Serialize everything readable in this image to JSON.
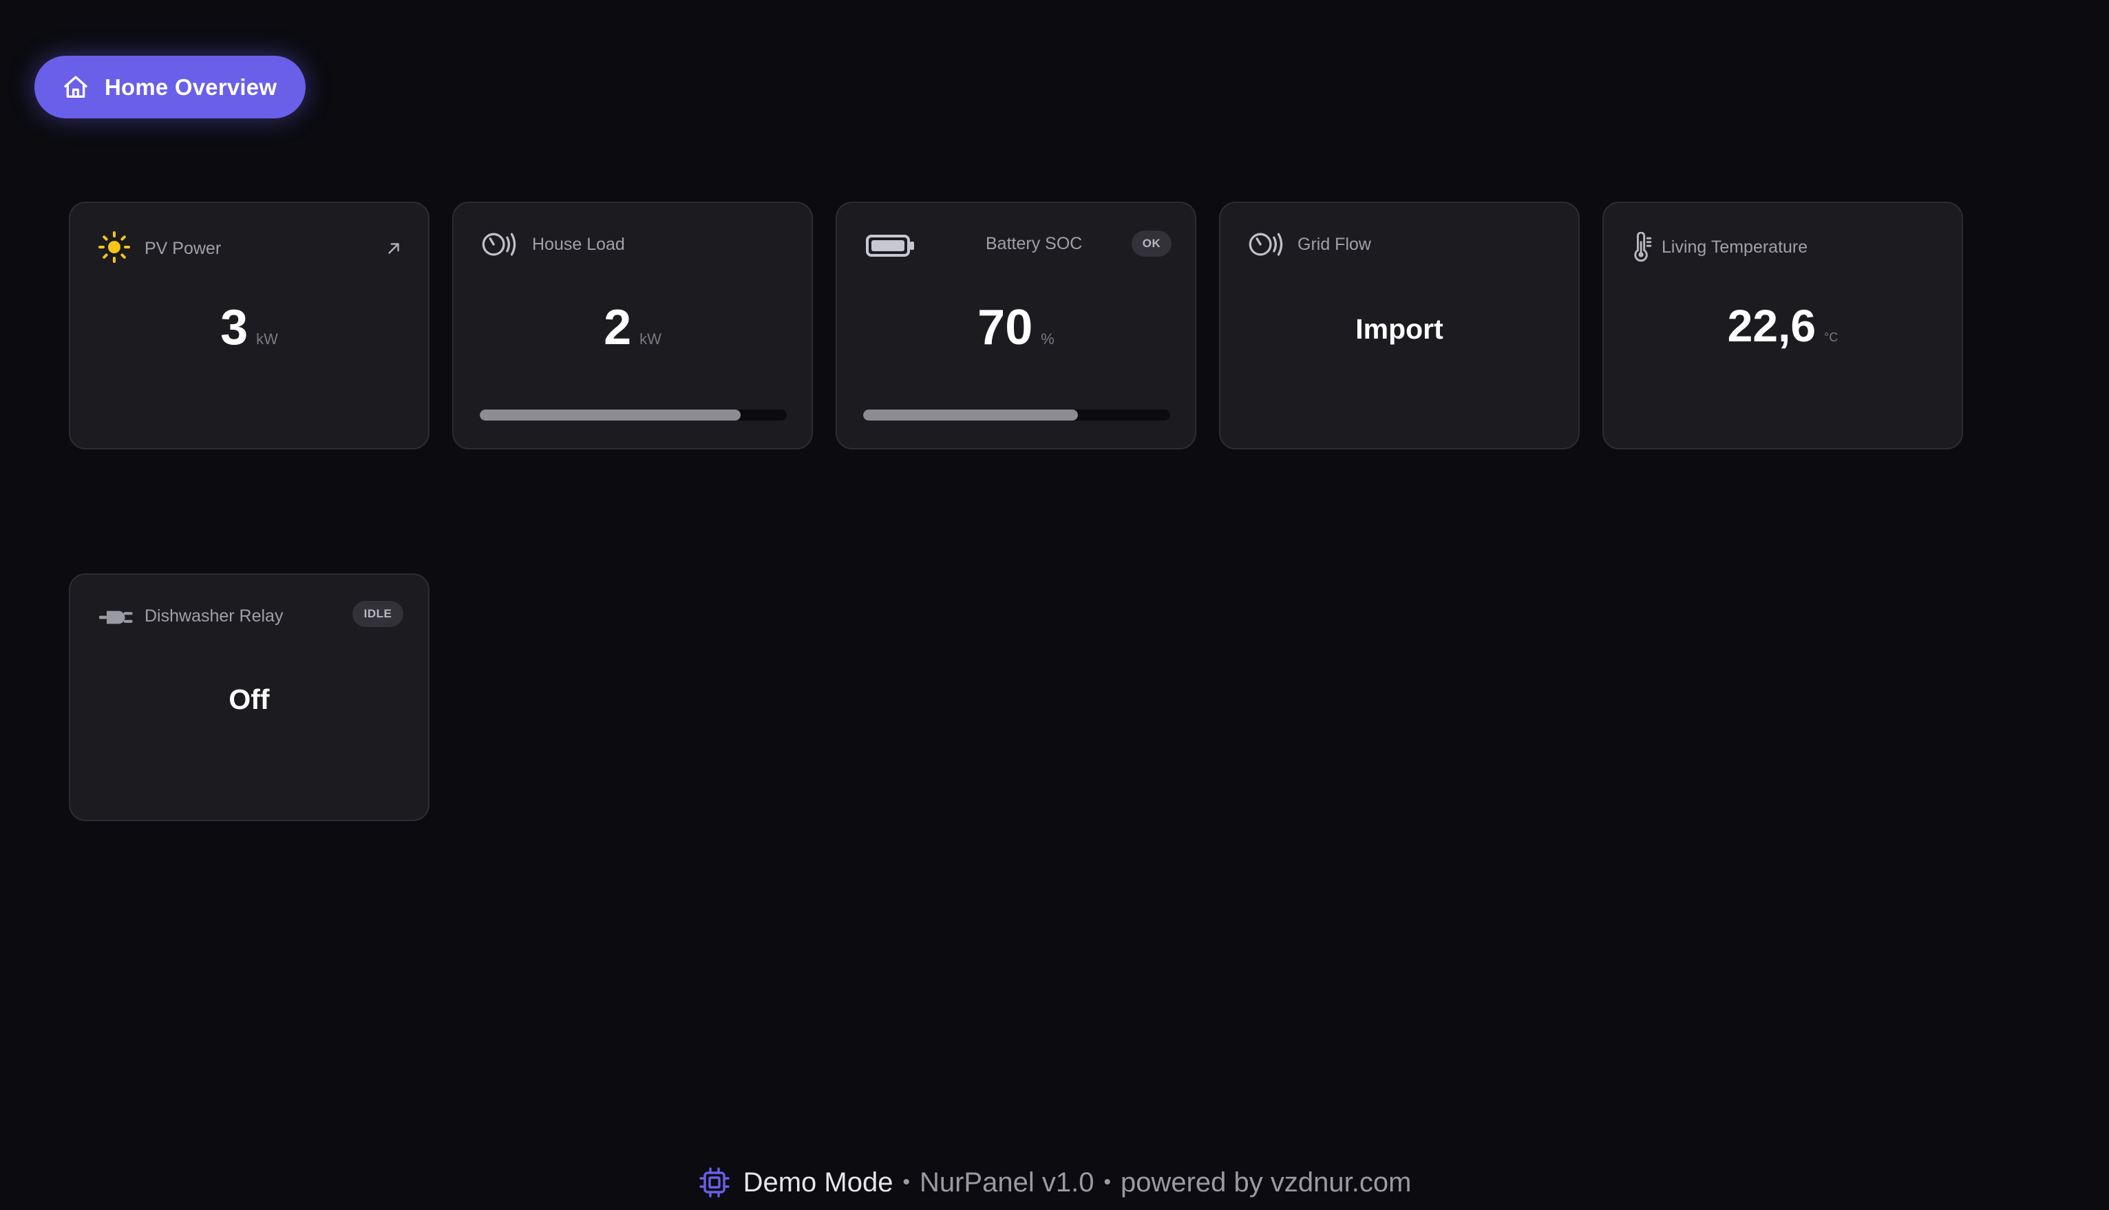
{
  "header": {
    "home_button_label": "Home Overview",
    "home_icon": "home-icon",
    "accent_color": "#6a5fe8"
  },
  "cards": [
    {
      "title": "PV Power",
      "icon": "sun-icon",
      "value": "3",
      "unit": "kW",
      "trend_icon": "arrow-up-right-icon"
    },
    {
      "title": "House Load",
      "icon": "gauge-icon",
      "value": "2",
      "unit": "kW",
      "progress": 0.85
    },
    {
      "title": "Battery SOC",
      "icon": "battery-icon",
      "value": "70",
      "unit": "%",
      "badge": "OK",
      "progress": 0.7
    },
    {
      "title": "Grid Flow",
      "icon": "gauge-icon",
      "text_value": "Import"
    },
    {
      "title": "Living Temperature",
      "icon": "thermometer-icon",
      "value": "22,6",
      "unit": "°C"
    },
    {
      "title": "Dishwasher Relay",
      "icon": "plug-icon",
      "badge": "IDLE",
      "text_value": "Off"
    }
  ],
  "footer": {
    "mode": "Demo Mode",
    "product": "NurPanel v1.0",
    "powered_by": "powered by vzdnur.com",
    "separator": "•",
    "icon": "chip-icon"
  }
}
